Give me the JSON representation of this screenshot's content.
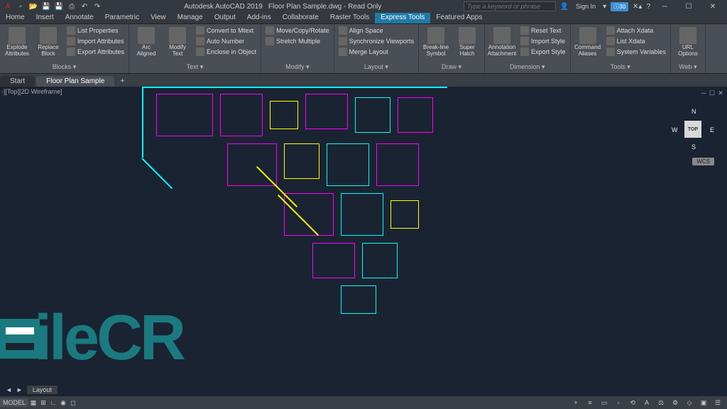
{
  "titlebar": {
    "app": "Autodesk AutoCAD 2019",
    "doc": "Floor Plan Sample.dwg - Read Only",
    "search_placeholder": "Type a keyword or phrase",
    "signin": "Sign In",
    "info_badge": "30"
  },
  "menu": [
    "Home",
    "Insert",
    "Annotate",
    "Parametric",
    "View",
    "Manage",
    "Output",
    "Add-ins",
    "Collaborate",
    "Raster Tools",
    "Express Tools",
    "Featured Apps"
  ],
  "menu_active": 10,
  "ribbon": {
    "groups": [
      {
        "title": "Blocks",
        "big": [
          {
            "label": "Explode\nAttributes"
          },
          {
            "label": "Replace\nBlock"
          }
        ],
        "rows": [
          "List Properties",
          "Import Attributes",
          "Export Attributes"
        ]
      },
      {
        "title": "Text",
        "big": [
          {
            "label": "Arc\nAligned"
          },
          {
            "label": "Modify\nText"
          }
        ],
        "rows": [
          "Convert to Mtext",
          "Auto Number",
          "Enclose in Object"
        ]
      },
      {
        "title": "Modify",
        "rows": [
          "Move/Copy/Rotate",
          "Stretch Multiple"
        ]
      },
      {
        "title": "Layout",
        "rows": [
          "Align Space",
          "Synchronize Viewports",
          "Merge Layout"
        ]
      },
      {
        "title": "Draw",
        "big": [
          {
            "label": "Break-line\nSymbol"
          },
          {
            "label": "Super\nHatch"
          }
        ]
      },
      {
        "title": "Dimension",
        "big": [
          {
            "label": "Annotation\nAttachment"
          }
        ],
        "rows": [
          "Reset Text",
          "Import Style",
          "Export Style"
        ]
      },
      {
        "title": "Tools",
        "big": [
          {
            "label": "Command\nAliases"
          }
        ],
        "rows": [
          "Attach Xdata",
          "List Xdata",
          "System Variables"
        ]
      },
      {
        "title": "Web",
        "big": [
          {
            "label": "URL\nOptions"
          }
        ]
      }
    ]
  },
  "file_tabs": {
    "items": [
      "Start",
      "Floor Plan Sample"
    ],
    "active": 1
  },
  "viewport": {
    "label": "-][Top][2D Wireframe]",
    "cube_face": "TOP",
    "cube_n": "N",
    "cube_s": "S",
    "cube_e": "E",
    "cube_w": "W",
    "wcs": "WCS"
  },
  "watermark": "ileCR",
  "layout": {
    "tab": "Layout"
  },
  "status": {
    "model": "MODEL"
  }
}
